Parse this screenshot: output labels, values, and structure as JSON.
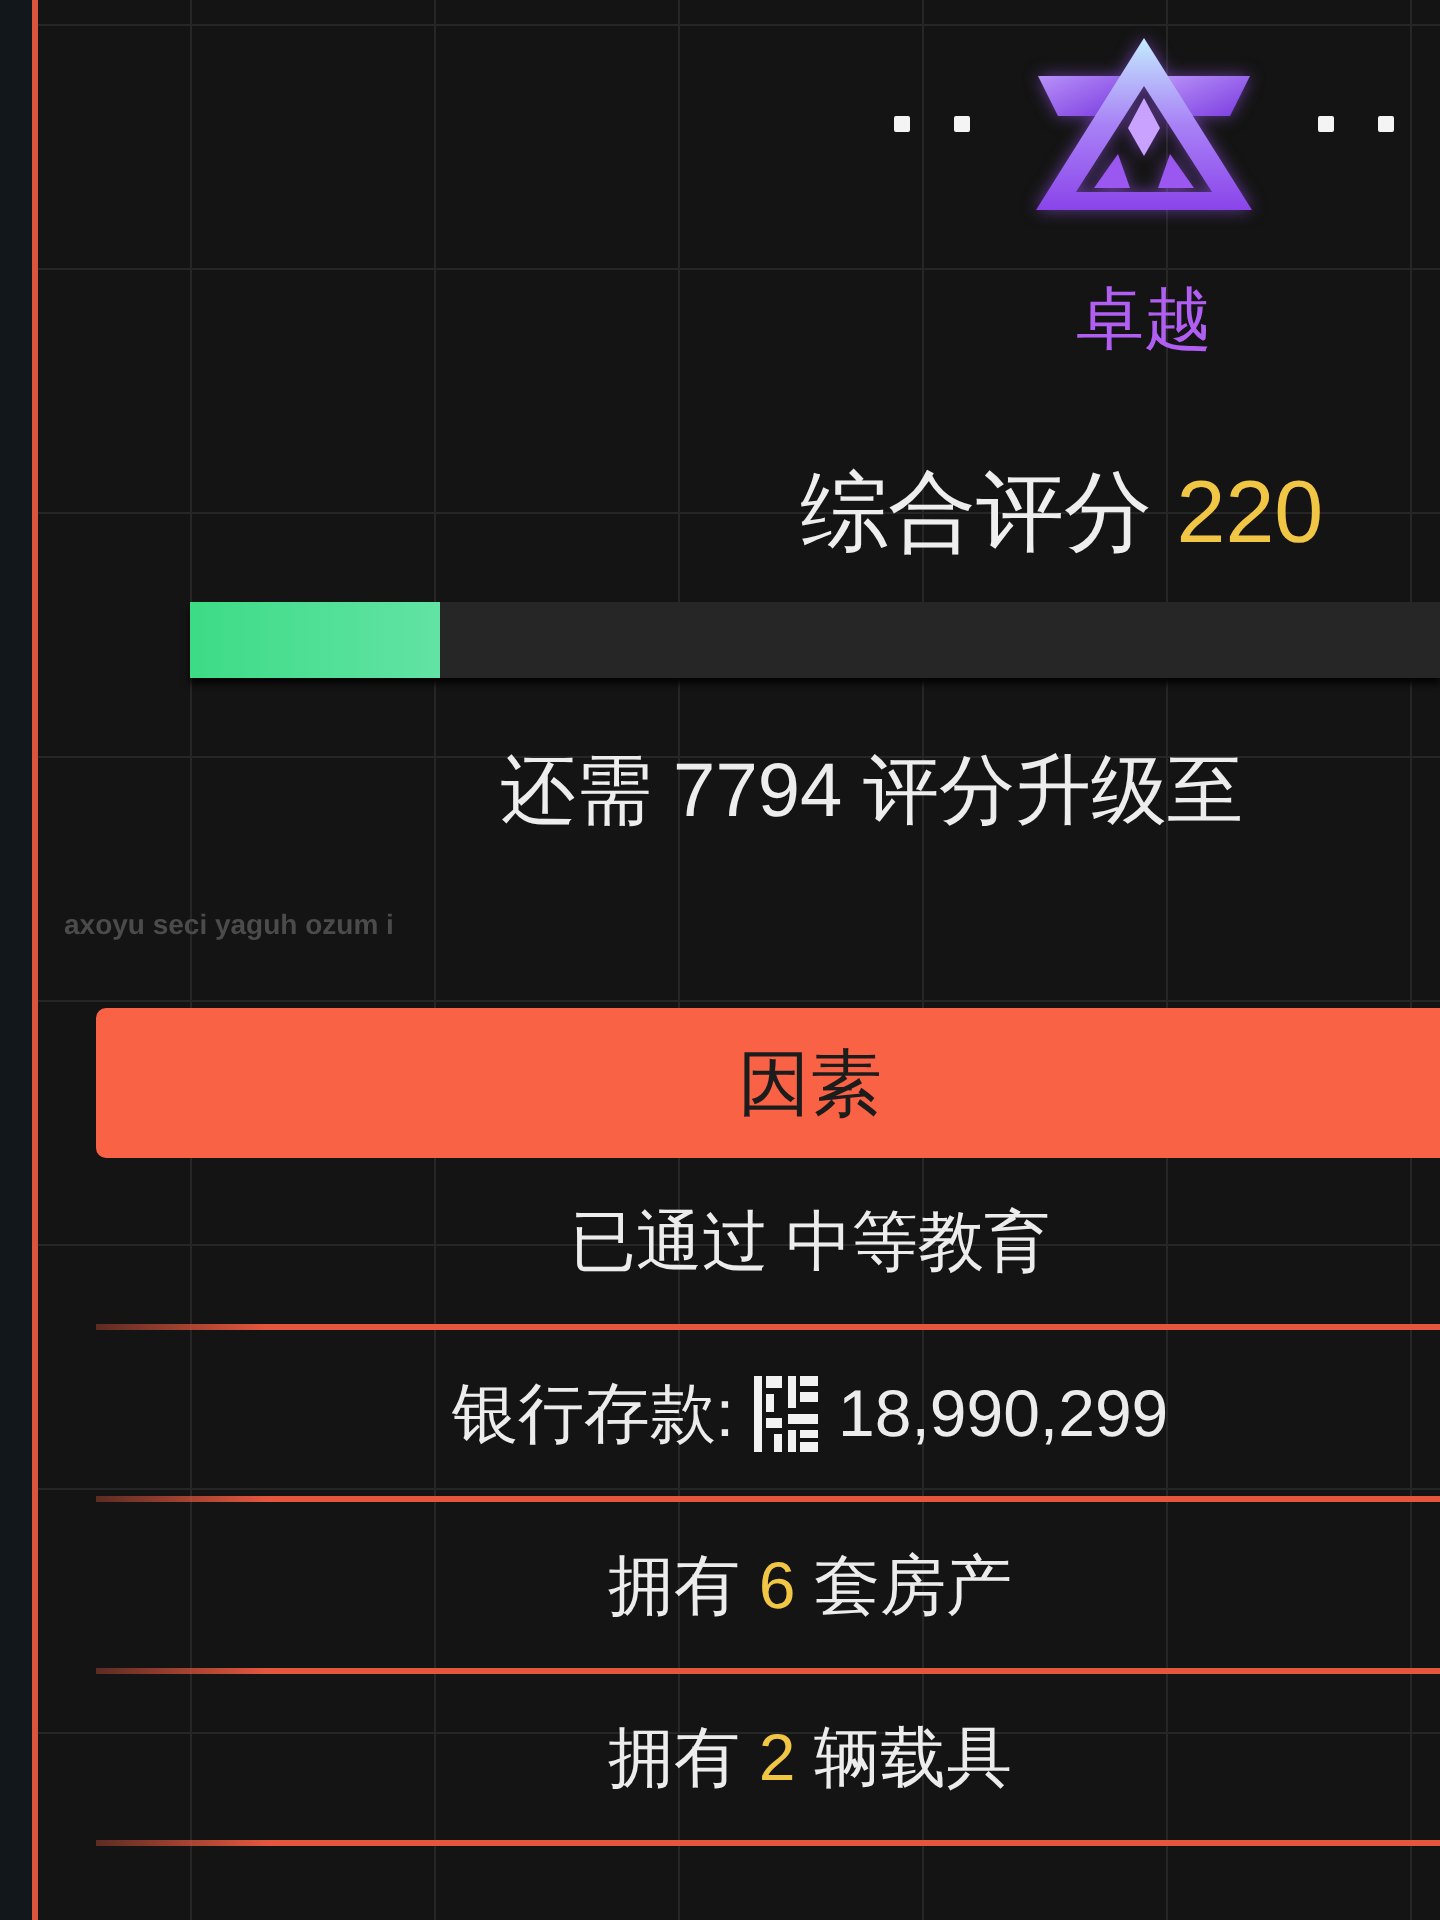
{
  "rank": {
    "name": "卓越"
  },
  "score": {
    "label": "综合评分",
    "value": "220",
    "level": 0.2
  },
  "upgrade_hint": "还需 7794 评分升级至",
  "caption": "axoyu seci yaguh ozum i",
  "factors": {
    "title": "因素",
    "rows": [
      {
        "kind": "text",
        "parts": [
          {
            "kind": "plain",
            "text": "已通过 中等教育"
          }
        ]
      },
      {
        "kind": "currency",
        "label": "银行存款:",
        "amount": "18,990,299"
      },
      {
        "kind": "text",
        "parts": [
          {
            "kind": "plain",
            "text": "拥有 "
          },
          {
            "kind": "count",
            "text": "6"
          },
          {
            "kind": "plain",
            "text": " 套房产"
          }
        ]
      },
      {
        "kind": "text",
        "parts": [
          {
            "kind": "plain",
            "text": "拥有 "
          },
          {
            "kind": "count",
            "text": "2"
          },
          {
            "kind": "plain",
            "text": " 辆载具"
          }
        ]
      }
    ]
  }
}
